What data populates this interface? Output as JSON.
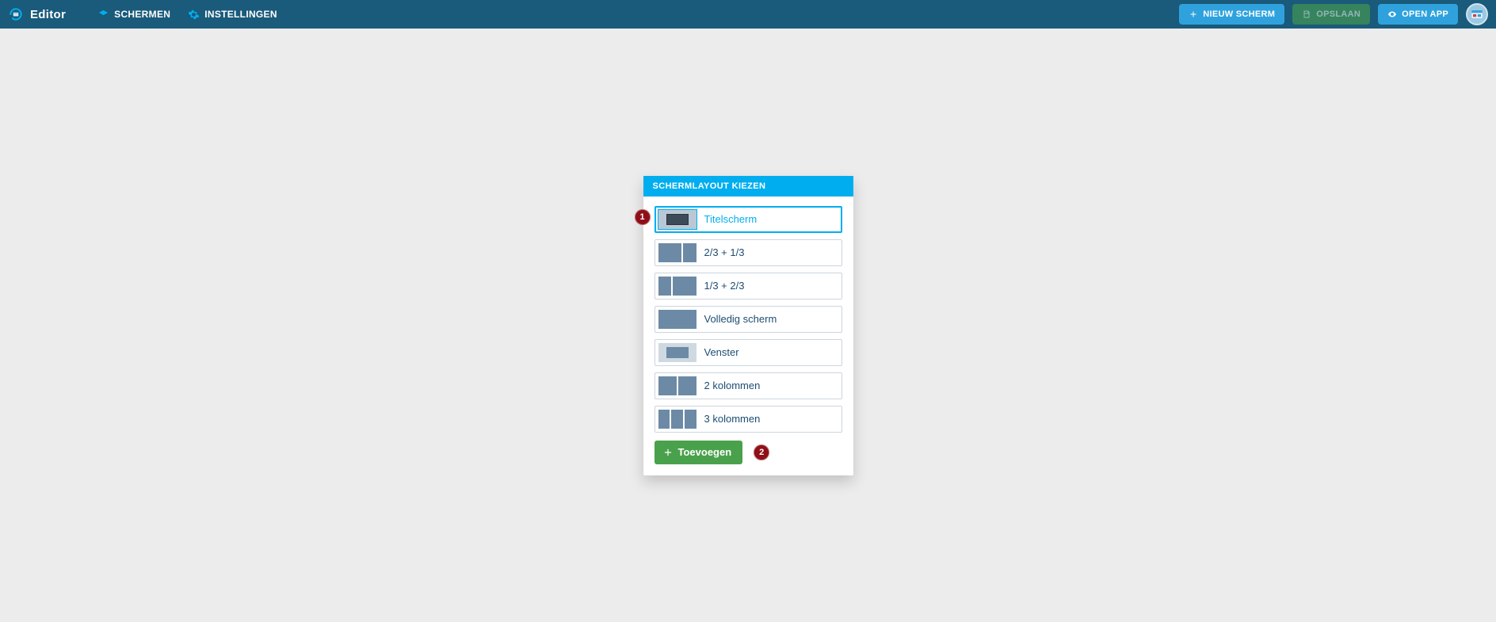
{
  "app": {
    "title": "Editor"
  },
  "nav": {
    "schermen": "SCHERMEN",
    "instellingen": "INSTELLINGEN"
  },
  "toolbar": {
    "nieuw_scherm": "NIEUW SCHERM",
    "opslaan": "OPSLAAN",
    "open_app": "OPEN APP"
  },
  "modal": {
    "title": "SCHERMLAYOUT KIEZEN",
    "options": [
      {
        "id": "titelscherm",
        "label": "Titelscherm",
        "selected": true
      },
      {
        "id": "two-third-one-third",
        "label": "2/3 + 1/3",
        "selected": false
      },
      {
        "id": "one-third-two-third",
        "label": "1/3 + 2/3",
        "selected": false
      },
      {
        "id": "full",
        "label": "Volledig scherm",
        "selected": false
      },
      {
        "id": "window",
        "label": "Venster",
        "selected": false
      },
      {
        "id": "cols2",
        "label": "2 kolommen",
        "selected": false
      },
      {
        "id": "cols3",
        "label": "3 kolommen",
        "selected": false
      }
    ],
    "add_label": "Toevoegen"
  },
  "callouts": {
    "one": "1",
    "two": "2"
  }
}
